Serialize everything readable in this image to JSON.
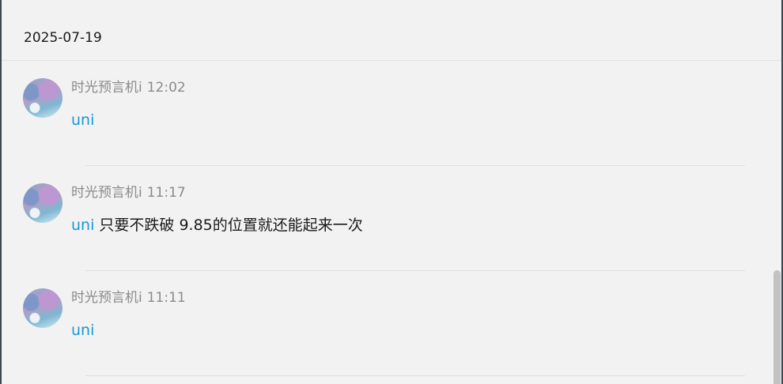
{
  "date_header": "2025-07-19",
  "posts": [
    {
      "author": "时光预言机i",
      "time": "12:02",
      "mention": "uni",
      "text": ""
    },
    {
      "author": "时光预言机i",
      "time": "11:17",
      "mention": "uni",
      "text": "只要不跌破 9.85的位置就还能起来一次"
    },
    {
      "author": "时光预言机i",
      "time": "11:11",
      "mention": "uni",
      "text": ""
    }
  ]
}
